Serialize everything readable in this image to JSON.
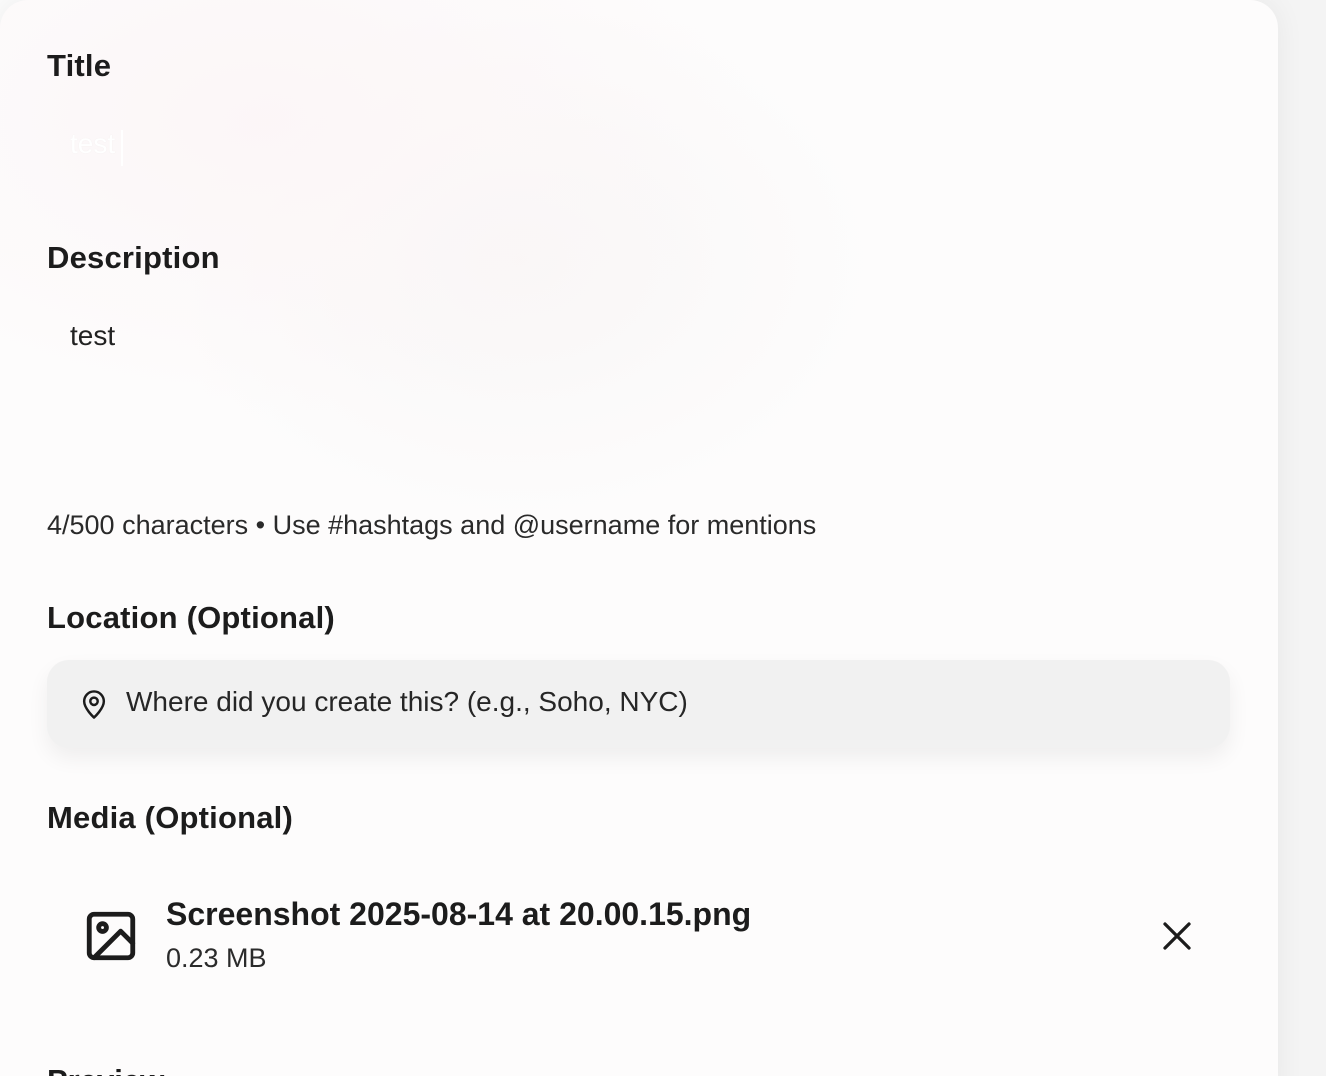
{
  "form": {
    "title": {
      "label": "Title",
      "value": "test"
    },
    "description": {
      "label": "Description",
      "value": "test",
      "helper": "4/500 characters • Use #hashtags and @username for mentions"
    },
    "location": {
      "label": "Location (Optional)",
      "placeholder": "Where did you create this? (e.g., Soho, NYC)",
      "icon": "map-pin-icon"
    },
    "media": {
      "label": "Media (Optional)",
      "file_name": "Screenshot 2025-08-14 at 20.00.15.png",
      "file_size": "0.23 MB",
      "file_icon": "image-icon",
      "remove_icon": "close-icon"
    },
    "next_section_label": "Preview"
  },
  "colors": {
    "card_background": "#fdfcfc",
    "location_field": "#f1f1f1",
    "text_primary": "#1c1c1c"
  }
}
